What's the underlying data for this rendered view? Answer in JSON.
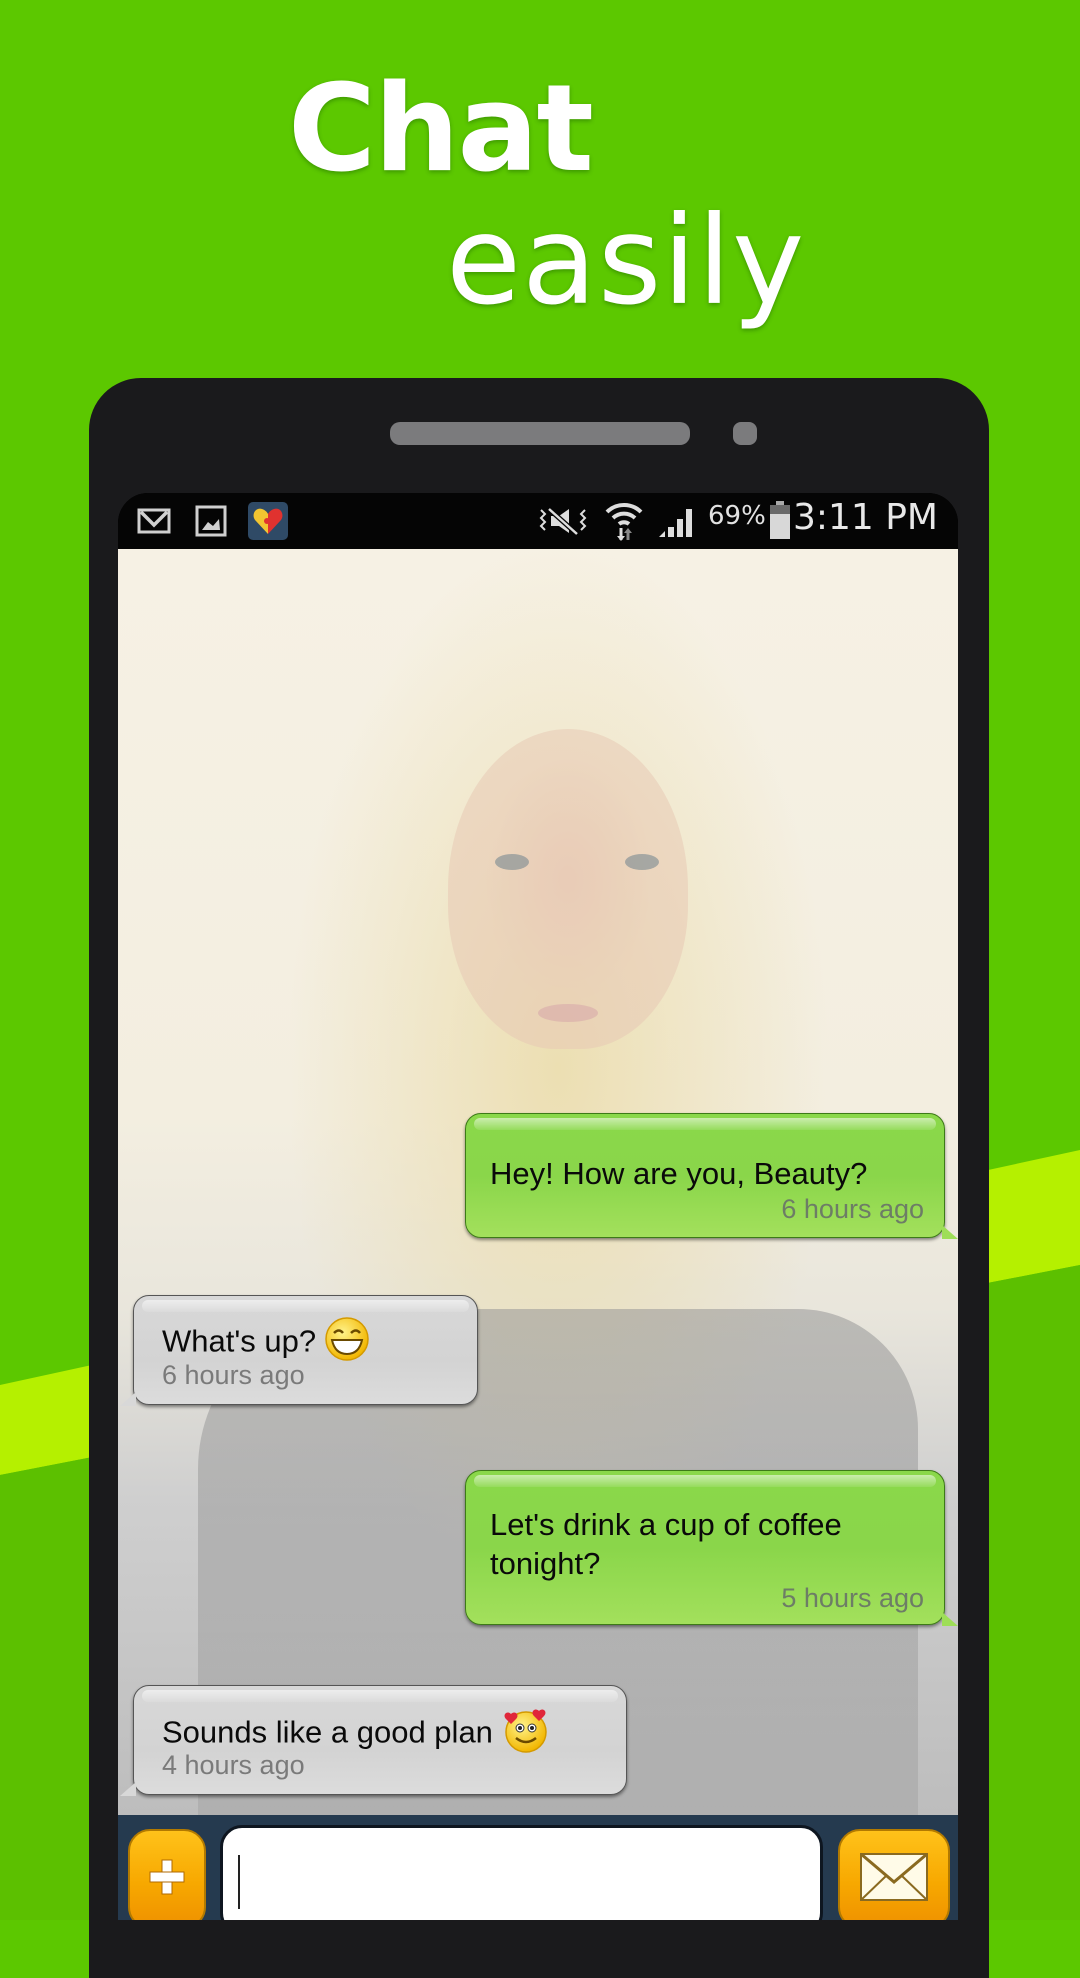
{
  "promo": {
    "headline_line1": "Chat",
    "headline_line2": "easily",
    "background_color": "#5cc800",
    "stripe_color": "#b5f000"
  },
  "status_bar": {
    "left_icons": [
      "gmail-icon",
      "gallery-icon",
      "heart-puzzle-app-icon"
    ],
    "right_icons": [
      "vibrate-mute-icon",
      "wifi-icon",
      "signal-icon",
      "battery-icon"
    ],
    "battery_percent": "69%",
    "time": "3:11 PM"
  },
  "chat": {
    "messages": [
      {
        "direction": "outgoing",
        "text": "Hey! How are you, Beauty?",
        "time": "6 hours ago",
        "emoji": ""
      },
      {
        "direction": "incoming",
        "text": "What's up?",
        "time": "6 hours ago",
        "emoji": "grinning-face"
      },
      {
        "direction": "outgoing",
        "text": "Let's drink a cup of coffee tonight?",
        "time": "5 hours ago",
        "emoji": ""
      },
      {
        "direction": "incoming",
        "text": "Sounds like a good plan",
        "time": "4 hours ago",
        "emoji": "heart-eyes-face"
      }
    ],
    "outgoing_color": "#8ad84a",
    "incoming_color": "#d6d6d6"
  },
  "composer": {
    "add_button_icon": "plus-icon",
    "input_value": "",
    "input_placeholder": "",
    "send_button_icon": "envelope-icon",
    "button_color": "#f7a800"
  }
}
